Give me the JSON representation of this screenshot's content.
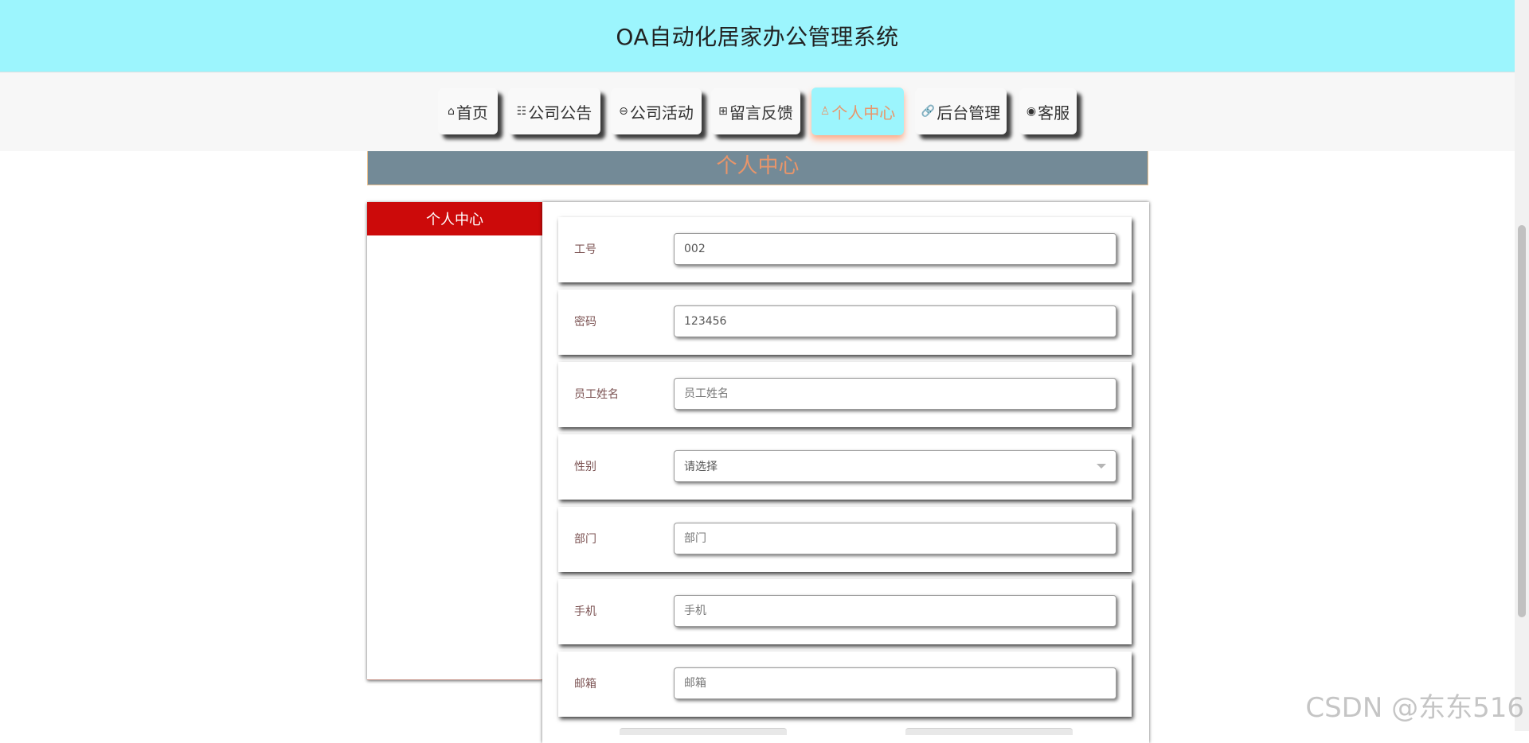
{
  "header": {
    "title": "OA自动化居家办公管理系统"
  },
  "nav": {
    "items": [
      {
        "icon": "⌂",
        "label": "首页"
      },
      {
        "icon": "☷",
        "label": "公司公告"
      },
      {
        "icon": "⊖",
        "label": "公司活动"
      },
      {
        "icon": "⊞",
        "label": "留言反馈"
      },
      {
        "icon": "♙",
        "label": "个人中心"
      },
      {
        "icon": "🔗",
        "label": "后台管理"
      },
      {
        "icon": "◉",
        "label": "客服"
      }
    ],
    "active": "个人中心"
  },
  "banner": {
    "title": "个人中心"
  },
  "sidebar": {
    "title": "个人中心"
  },
  "form": {
    "fields": [
      {
        "label": "工号",
        "value": "002",
        "placeholder": ""
      },
      {
        "label": "密码",
        "value": "123456",
        "placeholder": ""
      },
      {
        "label": "员工姓名",
        "value": "",
        "placeholder": "员工姓名"
      },
      {
        "label": "性别",
        "value": "请选择",
        "type": "select"
      },
      {
        "label": "部门",
        "value": "",
        "placeholder": "部门"
      },
      {
        "label": "手机",
        "value": "",
        "placeholder": "手机"
      },
      {
        "label": "邮箱",
        "value": "",
        "placeholder": "邮箱"
      }
    ]
  },
  "watermark": "CSDN @东东516",
  "colors": {
    "header_bg": "#9cf5fd",
    "active_tab_text": "#e8956a",
    "sidebar_title_bg": "#cc0a0a",
    "banner_bg": "#738a97"
  }
}
